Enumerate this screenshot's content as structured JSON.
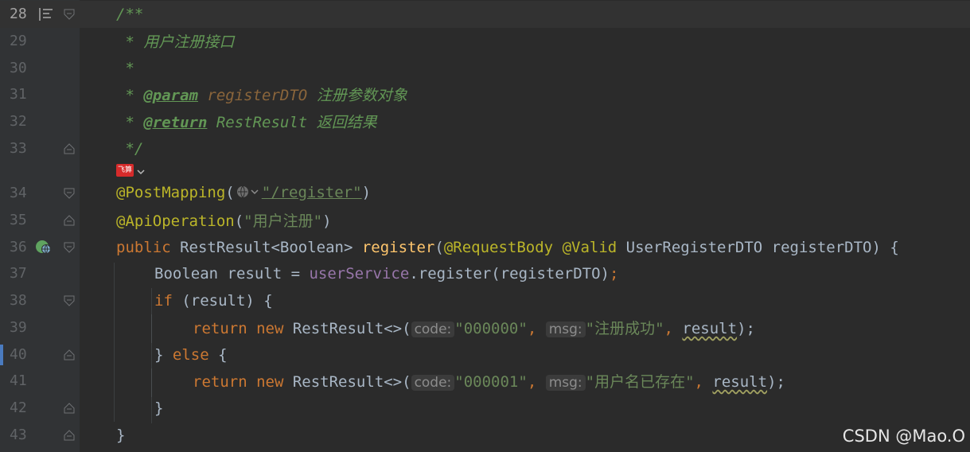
{
  "editor": {
    "lines": [
      {
        "num": "28"
      },
      {
        "num": "29"
      },
      {
        "num": "30"
      },
      {
        "num": "31"
      },
      {
        "num": "32"
      },
      {
        "num": "33"
      },
      {
        "num": "34"
      },
      {
        "num": "35"
      },
      {
        "num": "36"
      },
      {
        "num": "37"
      },
      {
        "num": "38"
      },
      {
        "num": "39"
      },
      {
        "num": "40"
      },
      {
        "num": "41"
      },
      {
        "num": "42"
      },
      {
        "num": "43"
      }
    ],
    "doc": {
      "open": "/**",
      "summary": " * 用户注册接口",
      "blank": " *",
      "param_prefix": " * ",
      "param_tag": "@param",
      "param_name": " registerDTO",
      "param_desc": " 注册参数对象",
      "return_prefix": " * ",
      "return_tag": "@return",
      "return_desc": " RestResult 返回结果",
      "close": " */"
    },
    "inlay": {
      "author_badge": "飞算"
    },
    "post_mapping": {
      "annotation": "@PostMapping",
      "open": "(",
      "path": "\"/register\"",
      "close": ")"
    },
    "api_operation": {
      "annotation": "@ApiOperation",
      "open": "(",
      "text": "\"用户注册\"",
      "close": ")"
    },
    "method_sig": {
      "public": "public",
      "ret_type": " RestResult<Boolean> ",
      "name": "register",
      "open": "(",
      "ann1": "@RequestBody",
      "space": " ",
      "ann2": "@Valid",
      "params": " UserRegisterDTO registerDTO) {"
    },
    "line37": {
      "pre": "Boolean result = ",
      "field": "userService",
      "post": ".register(registerDTO)",
      "semi": ";"
    },
    "line38": {
      "kw": "if",
      "rest": " (result) {"
    },
    "line39": {
      "kw_return": "return",
      "kw_new": " new ",
      "cls": "RestResult<>(",
      "hint_code": "code:",
      "code": "\"000000\"",
      "comma": ", ",
      "hint_msg": "msg:",
      "msg": "\"注册成功\"",
      "comma2": ", ",
      "result": "result",
      "end": ");"
    },
    "line40": {
      "brace": "} ",
      "kw": "else",
      "rest": " {"
    },
    "line41": {
      "kw_return": "return",
      "kw_new": " new ",
      "cls": "RestResult<>(",
      "hint_code": "code:",
      "code": "\"000001\"",
      "comma": ", ",
      "hint_msg": "msg:",
      "msg": "\"用户名已存在\"",
      "comma2": ", ",
      "result": "result",
      "end": ");"
    },
    "line42": {
      "brace": "}"
    },
    "line43": {
      "brace": "}"
    }
  },
  "watermark": "CSDN @Mao.O",
  "colors": {
    "background": "#2b2b2b",
    "keyword": "#cc7832",
    "string": "#6a8759",
    "annotation": "#bbb529",
    "comment": "#629755",
    "function": "#ffc66d"
  }
}
